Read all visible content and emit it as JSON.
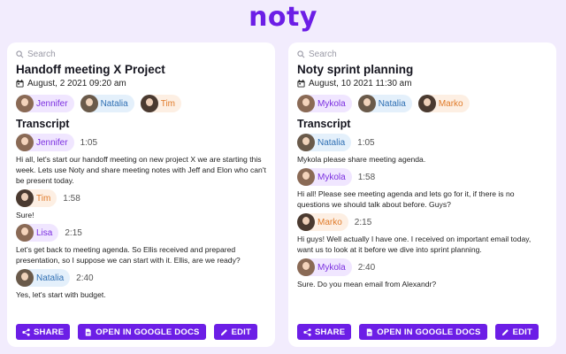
{
  "app": {
    "logo": "noty",
    "accent": "#6c1ee6"
  },
  "chip_colors": {
    "purple": {
      "bg": "#f0e6ff",
      "fg": "#7b2fe0",
      "avatar": "#8a6a55"
    },
    "blue": {
      "bg": "#e4f0fb",
      "fg": "#2f6fb3",
      "avatar": "#6a5a4a"
    },
    "orange": {
      "bg": "#fdefe3",
      "fg": "#e07b2a",
      "avatar": "#4a3a30"
    }
  },
  "cards": [
    {
      "search_placeholder": "Search",
      "title": "Handoff meeting X Project",
      "date": "August, 2 2021 09:20 am",
      "participants": [
        {
          "name": "Jennifer",
          "color": "purple"
        },
        {
          "name": "Natalia",
          "color": "blue"
        },
        {
          "name": "Tim",
          "color": "orange"
        }
      ],
      "transcript_label": "Transcript",
      "transcript": [
        {
          "name": "Jennifer",
          "color": "purple",
          "time": "1:05",
          "text": "Hi all, let's start our handoff meeting on new project X we are starting this week. Lets use Noty and share meeting notes with Jeff and Elon who can't be present today."
        },
        {
          "name": "Tim",
          "color": "orange",
          "time": "1:58",
          "text": "Sure!"
        },
        {
          "name": "Lisa",
          "color": "purple",
          "time": "2:15",
          "text": "Let's get back to meeting agenda. So Ellis received and prepared presentation, so I suppose we can start with it. Ellis, are we ready?"
        },
        {
          "name": "Natalia",
          "color": "blue",
          "time": "2:40",
          "text": "Yes, let's start with budget."
        }
      ],
      "actions": {
        "share": "SHARE",
        "docs": "OPEN IN GOOGLE DOCS",
        "edit": "EDIT"
      }
    },
    {
      "search_placeholder": "Search",
      "title": "Noty sprint planning",
      "date": "August, 10 2021 11:30 am",
      "participants": [
        {
          "name": "Mykola",
          "color": "purple"
        },
        {
          "name": "Natalia",
          "color": "blue"
        },
        {
          "name": "Marko",
          "color": "orange"
        }
      ],
      "transcript_label": "Transcript",
      "transcript": [
        {
          "name": "Natalia",
          "color": "blue",
          "time": "1:05",
          "text": "Mykola please share meeting agenda."
        },
        {
          "name": "Mykola",
          "color": "purple",
          "time": "1:58",
          "text": "Hi all! Please see meeting agenda and lets go for it, if there is no questions we should talk about before. Guys?"
        },
        {
          "name": "Marko",
          "color": "orange",
          "time": "2:15",
          "text": "Hi guys! Well actually I have one. I received on important email today, want us to look at it before we dive into sprint planning."
        },
        {
          "name": "Mykola",
          "color": "purple",
          "time": "2:40",
          "text": "Sure. Do you mean email from Alexandr?"
        }
      ],
      "actions": {
        "share": "SHARE",
        "docs": "OPEN IN GOOGLE DOCS",
        "edit": "EDIT"
      }
    }
  ]
}
